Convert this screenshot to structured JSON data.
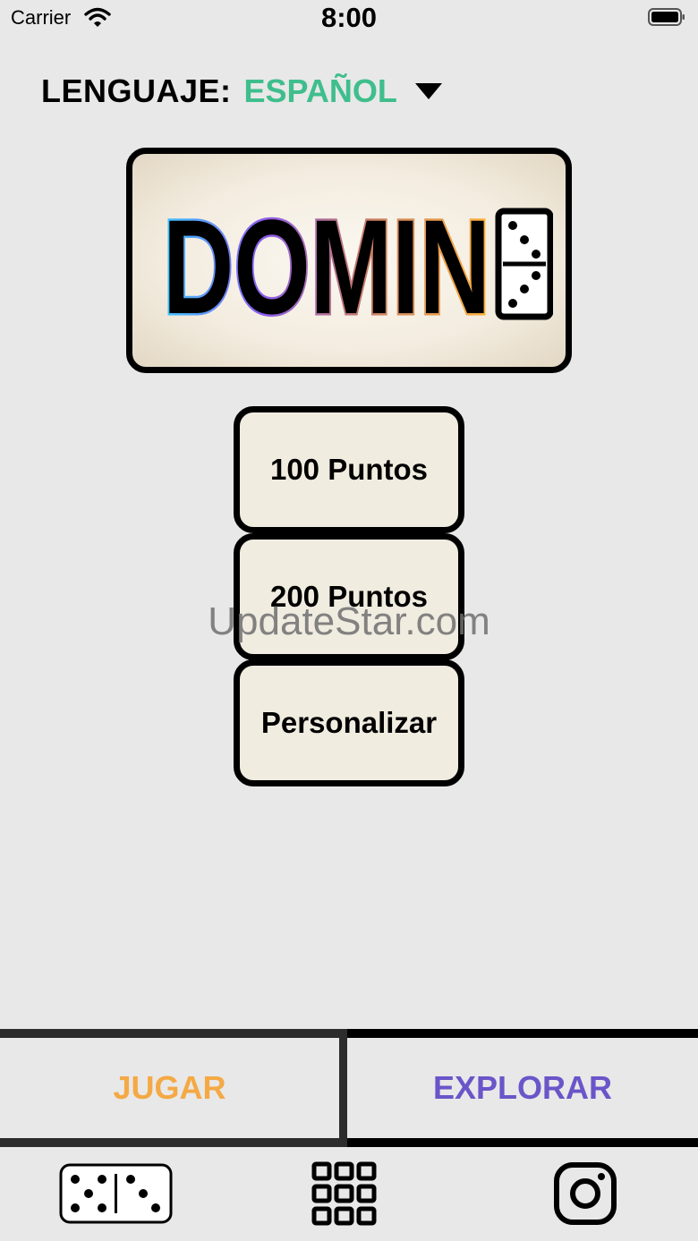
{
  "status_bar": {
    "carrier": "Carrier",
    "time": "8:00",
    "icons": [
      "wifi-icon",
      "battery-icon"
    ]
  },
  "language": {
    "label": "LENGUAJE:",
    "value": "ESPAÑOL",
    "value_color": "#3fbe8d",
    "dropdown_icon": "caret-down-icon"
  },
  "logo": {
    "text": "DOMIN",
    "domino_tile": {
      "top_pips": 3,
      "bottom_pips": 3
    }
  },
  "menu": {
    "options": [
      "100 Puntos",
      "200 Puntos",
      "Personalizar"
    ]
  },
  "watermark": "UpdateStar.com",
  "tabs": {
    "play": {
      "label": "JUGAR",
      "color": "#f4a944"
    },
    "explore": {
      "label": "EXPLORAR",
      "color": "#6a55c9"
    }
  },
  "bottom_icons": [
    "domino-icon",
    "grid-icon",
    "instagram-icon"
  ]
}
